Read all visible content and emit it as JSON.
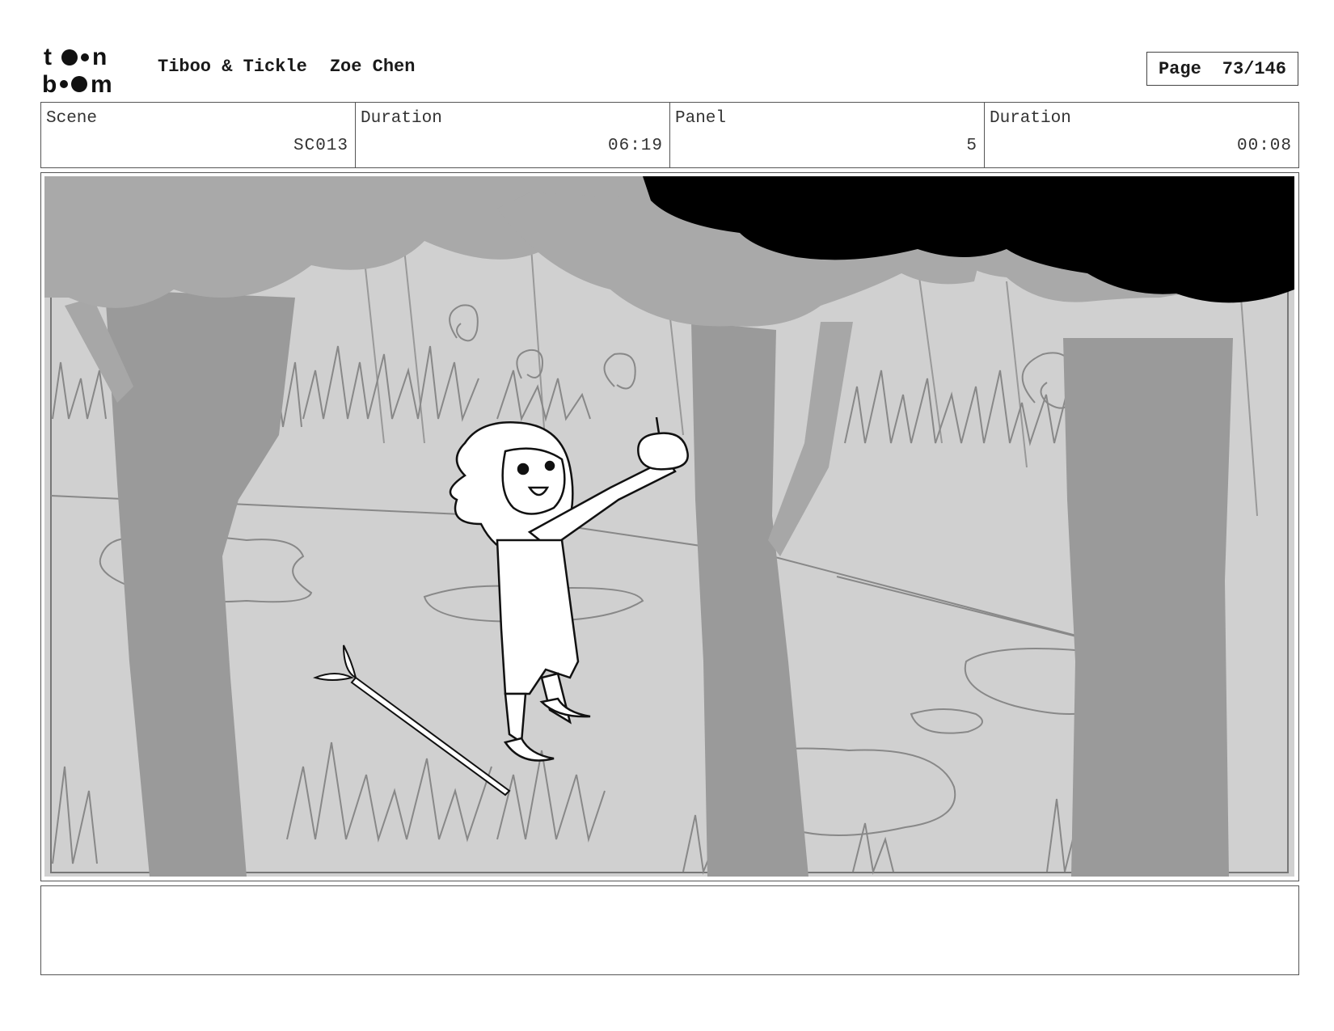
{
  "header": {
    "logo_alt": "toon boom",
    "project": "Tiboo & Tickle",
    "artist": "Zoe Chen",
    "page_label": "Page",
    "page_value": "73/146"
  },
  "info": {
    "scene_label": "Scene",
    "scene_value": "SC013",
    "scene_duration_label": "Duration",
    "scene_duration_value": "06:19",
    "panel_label": "Panel",
    "panel_value": "5",
    "panel_duration_label": "Duration",
    "panel_duration_value": "00:08"
  },
  "colors": {
    "sky": "#d0d0d0",
    "foliage": "#a9a9a9",
    "trunk": "#9a9a9a",
    "shadow_canopy": "#000000"
  },
  "notes": {
    "text": ""
  }
}
